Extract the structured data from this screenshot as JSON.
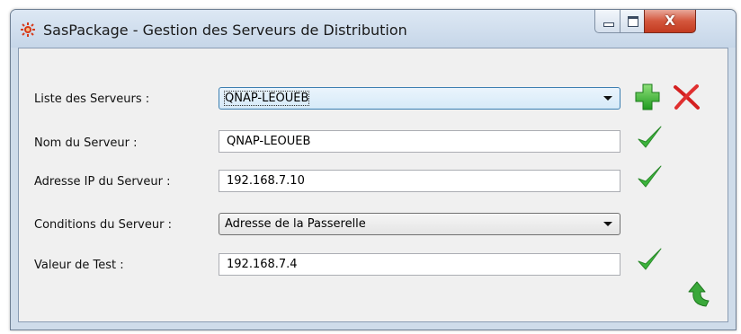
{
  "window": {
    "title": "SasPackage - Gestion des Serveurs de Distribution",
    "minimize": "_",
    "maximize": "□",
    "close": "X"
  },
  "form": {
    "server_list_label": "Liste des Serveurs :",
    "server_list_value": "QNAP-LEOUEB",
    "server_name_label": "Nom du Serveur :",
    "server_name_value": "QNAP-LEOUEB",
    "server_ip_label": "Adresse IP du Serveur :",
    "server_ip_value": "192.168.7.10",
    "conditions_label": "Conditions du Serveur :",
    "conditions_value": "Adresse de la Passerelle",
    "test_value_label": "Valeur de Test :",
    "test_value_value": "192.168.7.4"
  },
  "icons": {
    "app": "app-logo-icon",
    "add": "add-plus-icon",
    "delete": "delete-x-icon",
    "valid": "checkmark-icon",
    "refresh": "refresh-arrow-icon"
  },
  "colors": {
    "accent_green": "#3cb43c",
    "delete_red": "#d42020",
    "focus_blue": "#3c7fb1"
  }
}
